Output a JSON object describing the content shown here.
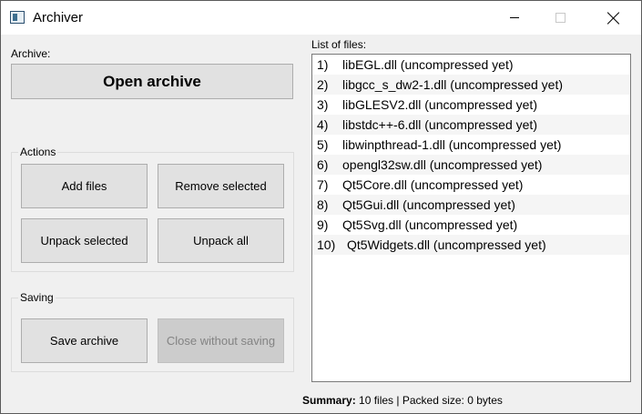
{
  "window": {
    "title": "Archiver"
  },
  "archive_section": {
    "label": "Archive:",
    "open_button": "Open archive"
  },
  "actions_group": {
    "title": "Actions",
    "add_files": "Add files",
    "remove_selected": "Remove selected",
    "unpack_selected": "Unpack selected",
    "unpack_all": "Unpack all"
  },
  "saving_group": {
    "title": "Saving",
    "save_archive": "Save archive",
    "close_without_saving": "Close without saving"
  },
  "file_list": {
    "label": "List of files:",
    "items": [
      {
        "num": "1)",
        "text": "libEGL.dll (uncompressed yet)"
      },
      {
        "num": "2)",
        "text": "libgcc_s_dw2-1.dll (uncompressed yet)"
      },
      {
        "num": "3)",
        "text": "libGLESV2.dll (uncompressed yet)"
      },
      {
        "num": "4)",
        "text": "libstdc++-6.dll (uncompressed yet)"
      },
      {
        "num": "5)",
        "text": "libwinpthread-1.dll (uncompressed yet)"
      },
      {
        "num": "6)",
        "text": "opengl32sw.dll (uncompressed yet)"
      },
      {
        "num": "7)",
        "text": "Qt5Core.dll (uncompressed yet)"
      },
      {
        "num": "8)",
        "text": "Qt5Gui.dll (uncompressed yet)"
      },
      {
        "num": "9)",
        "text": "Qt5Svg.dll (uncompressed yet)"
      },
      {
        "num": "10)",
        "text": "Qt5Widgets.dll (uncompressed yet)"
      }
    ]
  },
  "summary": {
    "label": "Summary:",
    "text": "10 files | Packed size: 0 bytes"
  },
  "icons": {
    "app": "archive-app-icon",
    "minimize": "minimize-icon",
    "maximize": "maximize-icon",
    "close": "close-icon"
  },
  "colors": {
    "window_bg": "#f0f0f0",
    "button_bg": "#e1e1e1",
    "button_disabled_bg": "#cccccc",
    "disabled_text": "#838383",
    "list_alt_row": "#f5f5f5"
  }
}
